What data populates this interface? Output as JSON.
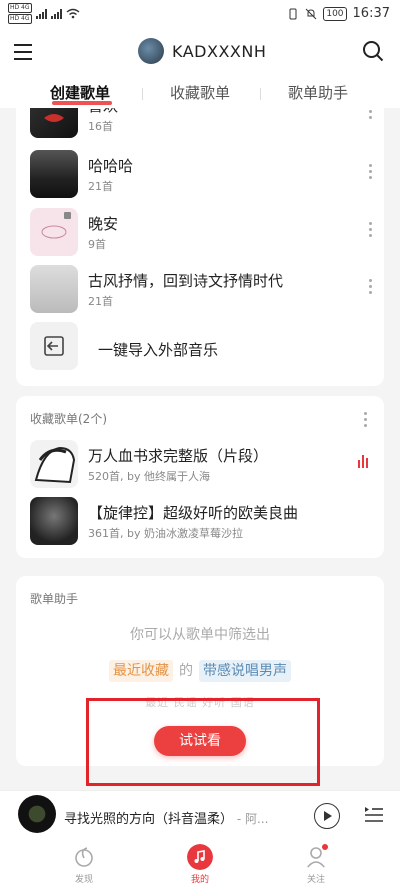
{
  "statusbar": {
    "sim1": "HD 4G",
    "sim2": "HD 4G",
    "battery": "100",
    "time": "16:37"
  },
  "header": {
    "username": "KADXXXNH"
  },
  "tabs": [
    {
      "label": "创建歌单"
    },
    {
      "label": "收藏歌单"
    },
    {
      "label": "歌单助手"
    }
  ],
  "created_playlists": [
    {
      "title": "喜欢",
      "count": "16首"
    },
    {
      "title": "哈哈哈",
      "count": "21首"
    },
    {
      "title": "晚安",
      "count": "9首"
    },
    {
      "title": "古风抒情，回到诗文抒情时代",
      "count": "21首"
    }
  ],
  "import": {
    "label": "一键导入外部音乐"
  },
  "collected": {
    "section_title": "收藏歌单(2个)",
    "items": [
      {
        "title": "万人血书求完整版（片段）",
        "sub": "520首, by 他终属于人海"
      },
      {
        "title": "【旋律控】超级好听的欧美良曲",
        "sub": "361首, by 奶油冰激凌草莓沙拉"
      }
    ]
  },
  "assistant": {
    "section_title": "歌单助手",
    "hint": "你可以从歌单中筛选出",
    "tag1": "最近收藏",
    "tag_joiner": "的",
    "tag2": "带感说唱男声",
    "faded_line": "最近 民谣 好听 国语",
    "button": "试试看"
  },
  "player": {
    "song": "寻找光照的方向（抖音温柔）",
    "artist": " - 阿..."
  },
  "bottom_nav": [
    {
      "label": "发现"
    },
    {
      "label": "我的"
    },
    {
      "label": "关注"
    }
  ],
  "colors": {
    "accent": "#ec3f3f",
    "highlight_frame": "#e2232a"
  }
}
